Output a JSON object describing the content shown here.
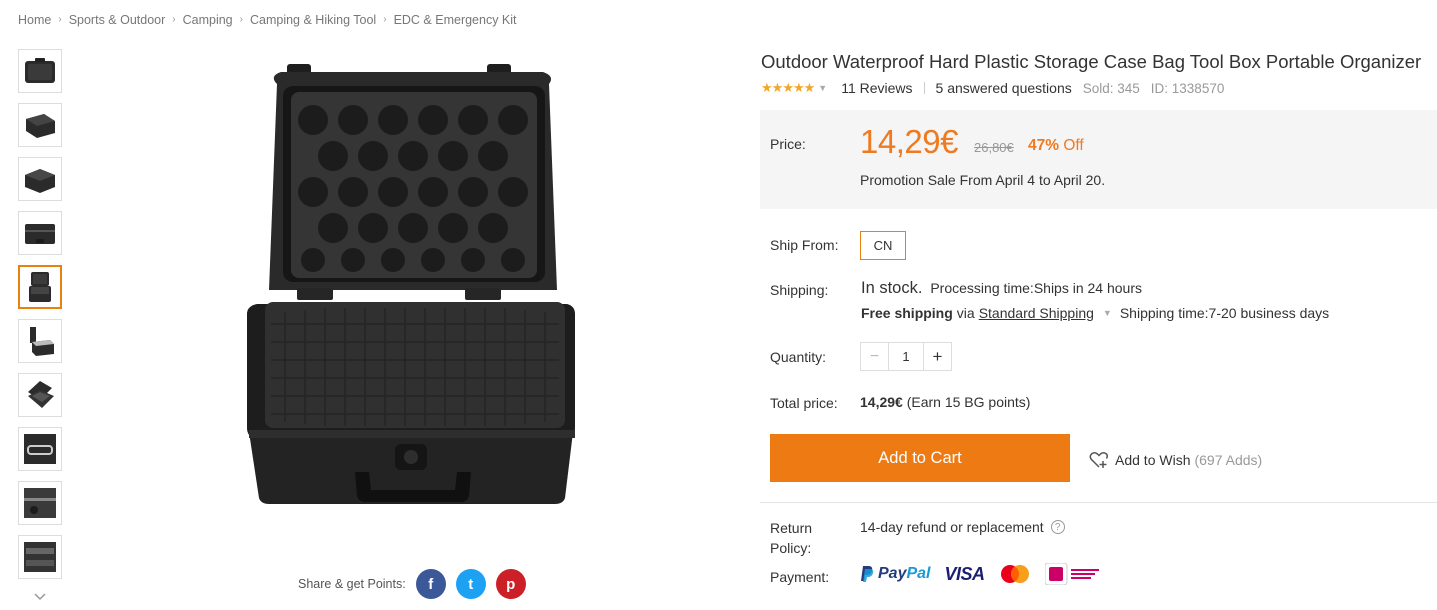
{
  "breadcrumb": [
    "Home",
    "Sports & Outdoor",
    "Camping",
    "Camping & Hiking Tool",
    "EDC & Emergency Kit"
  ],
  "product": {
    "title": "Outdoor Waterproof Hard Plastic Storage Case Bag Tool Box Portable Organizer",
    "rating": 5,
    "reviews": "11 Reviews",
    "answered": "5 answered questions",
    "sold": "Sold: 345",
    "id": "ID: 1338570"
  },
  "price": {
    "label": "Price:",
    "current": "14,29€",
    "original": "26,80€",
    "discount_pct": "47%",
    "discount_word": "Off",
    "promo": "Promotion Sale From April 4 to April 20."
  },
  "ship_from": {
    "label": "Ship From:",
    "value": "CN"
  },
  "shipping": {
    "label": "Shipping:",
    "status": "In stock.",
    "processing": "Processing time:Ships in 24 hours",
    "free": "Free shipping",
    "via": "via",
    "method": "Standard Shipping",
    "time": "Shipping time:7-20 business days"
  },
  "quantity": {
    "label": "Quantity:",
    "value": "1",
    "minus": "−",
    "plus": "+"
  },
  "total": {
    "label": "Total price:",
    "value": "14,29€",
    "points": "(Earn 15 BG points)"
  },
  "actions": {
    "add_to_cart": "Add to Cart",
    "add_to_wish": "Add to Wish",
    "wish_count": "(697 Adds)"
  },
  "return_policy": {
    "label": "Return Policy:",
    "value": "14-day refund or replacement",
    "help": "?"
  },
  "payment": {
    "label": "Payment:",
    "methods": [
      "PayPal",
      "VISA",
      "MasterCard",
      "iDEAL"
    ],
    "paypal_a": "Pay",
    "paypal_b": "Pal",
    "visa": "VISA"
  },
  "share": {
    "label": "Share & get Points:",
    "facebook": "f",
    "twitter": "t",
    "pinterest": "p"
  },
  "thumbnails": {
    "count": 10,
    "active_index": 4
  },
  "colors": {
    "accent": "#ee7a13",
    "price": "#ee7a21",
    "facebook": "#3b5998",
    "twitter": "#1da1f2",
    "pinterest": "#cb2027"
  },
  "icons": [
    "chevron-right-icon",
    "star-icon",
    "caret-down-icon",
    "heart-icon",
    "help-icon",
    "facebook-icon",
    "twitter-icon",
    "pinterest-icon",
    "chevron-down-icon"
  ]
}
